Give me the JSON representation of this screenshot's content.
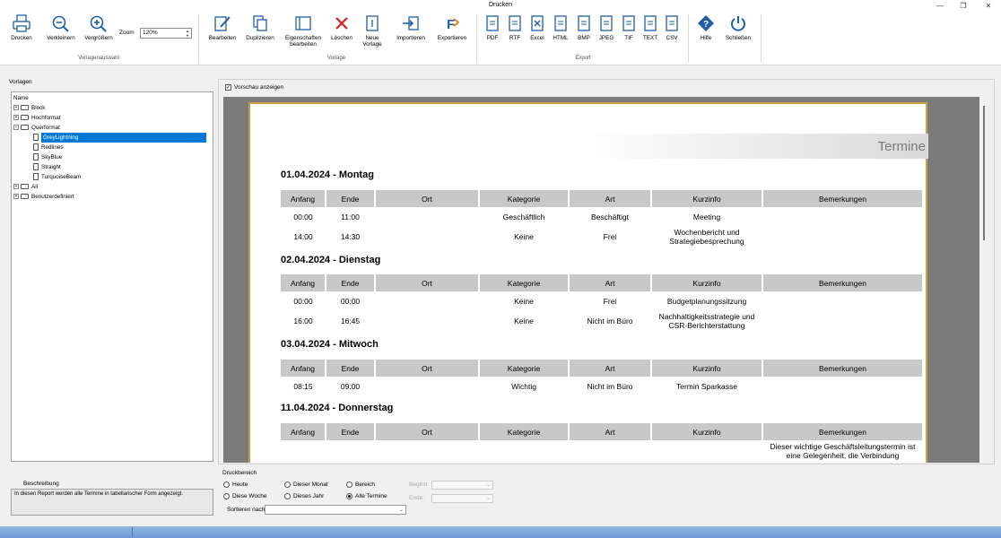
{
  "window": {
    "title": "Drucken",
    "minimize": "—",
    "restore": "❐",
    "close": "✕"
  },
  "ribbon": {
    "drucken": "Drucken",
    "verkleinern": "Verkleinern",
    "vergroessern": "Vergrößern",
    "zoom_label": "Zoom",
    "zoom_value": "120%",
    "group_vorlagenauswahl": "Vorlagenauswahl",
    "bearbeiten": "Bearbeiten",
    "duplizieren": "Duplizieren",
    "eigenschaften_1": "Eigenschaften",
    "eigenschaften_2": "bearbeiten",
    "loeschen": "Löschen",
    "neue_1": "Neue",
    "neue_2": "Vorlage",
    "importieren": "Importieren",
    "exportieren": "Exportieren",
    "group_vorlage": "Vorlage",
    "pdf": "PDF",
    "rtf": "RTF",
    "excel": "Excel",
    "html": "HTML",
    "bmp": "BMP",
    "jpeg": "JPEG",
    "tif": "TIF",
    "text": "TEXT",
    "csv": "CSV",
    "group_export": "Export",
    "hilfe": "Hilfe",
    "schliessen": "Schließen",
    "colors": {
      "primary_blue": "#1f5ea8",
      "delete_red": "#d42020",
      "export_orange": "#e07a1f"
    }
  },
  "vorlagen": {
    "title": "Vorlagen",
    "header": "Name",
    "items": [
      {
        "label": "Block"
      },
      {
        "label": "Hochformat"
      },
      {
        "label": "Querformat"
      },
      {
        "label": "GreyLightning"
      },
      {
        "label": "Redlines"
      },
      {
        "label": "SkyBlue"
      },
      {
        "label": "Straight"
      },
      {
        "label": "TurquoiseBeam"
      },
      {
        "label": "All"
      },
      {
        "label": "Benutzerdefiniert"
      }
    ]
  },
  "beschreibung": {
    "title": "Beschreibung",
    "text": "In diesen Report werden alle Termine in tabellarischer Form angezeigt."
  },
  "preview": {
    "show_label": "Vorschau anzeigen",
    "banner": "Termine",
    "columns": [
      "Anfang",
      "Ende",
      "Ort",
      "Kategorie",
      "Art",
      "Kurzinfo",
      "Bemerkungen"
    ],
    "days": [
      {
        "title": "01.04.2024 - Montag",
        "rows": [
          [
            "00:00",
            "11:00",
            "",
            "Geschäftlich",
            "Beschäftigt",
            "Meeting",
            ""
          ],
          [
            "14:00",
            "14:30",
            "",
            "Keine",
            "Frei",
            "Wochenbericht und Strategiebesprechung",
            ""
          ]
        ]
      },
      {
        "title": "02.04.2024 - Dienstag",
        "rows": [
          [
            "00:00",
            "00:00",
            "",
            "Keine",
            "Frei",
            "Budgetplanungssitzung",
            ""
          ],
          [
            "16:00",
            "16:45",
            "",
            "Keine",
            "Nicht im Büro",
            "Nachhaltigkeitsstrategie und CSR-Berichterstattung",
            ""
          ]
        ]
      },
      {
        "title": "03.04.2024 - Mitwoch",
        "rows": [
          [
            "08:15",
            "09:00",
            "",
            "Wichtig",
            "Nicht im Büro",
            "Termin Sparkasse",
            ""
          ]
        ]
      },
      {
        "title": "11.04.2024 - Donnerstag",
        "rows": [
          [
            "",
            "",
            "",
            "",
            "",
            "",
            "Dieser wichtige Geschäftsleitungstermin ist eine Gelegenheit, die Verbindung"
          ]
        ]
      }
    ]
  },
  "druckbereich": {
    "title": "Druckbereich",
    "heute": "Heute",
    "diese_woche": "Diese Woche",
    "dieser_monat": "Dieser Monat",
    "dieses_jahr": "Dieses Jahr",
    "bereich": "Bereich",
    "alle_termine": "Alle Termine",
    "beginn": "Beginn:",
    "ende": "Ende:",
    "sortieren": "Sortieren nach:"
  }
}
